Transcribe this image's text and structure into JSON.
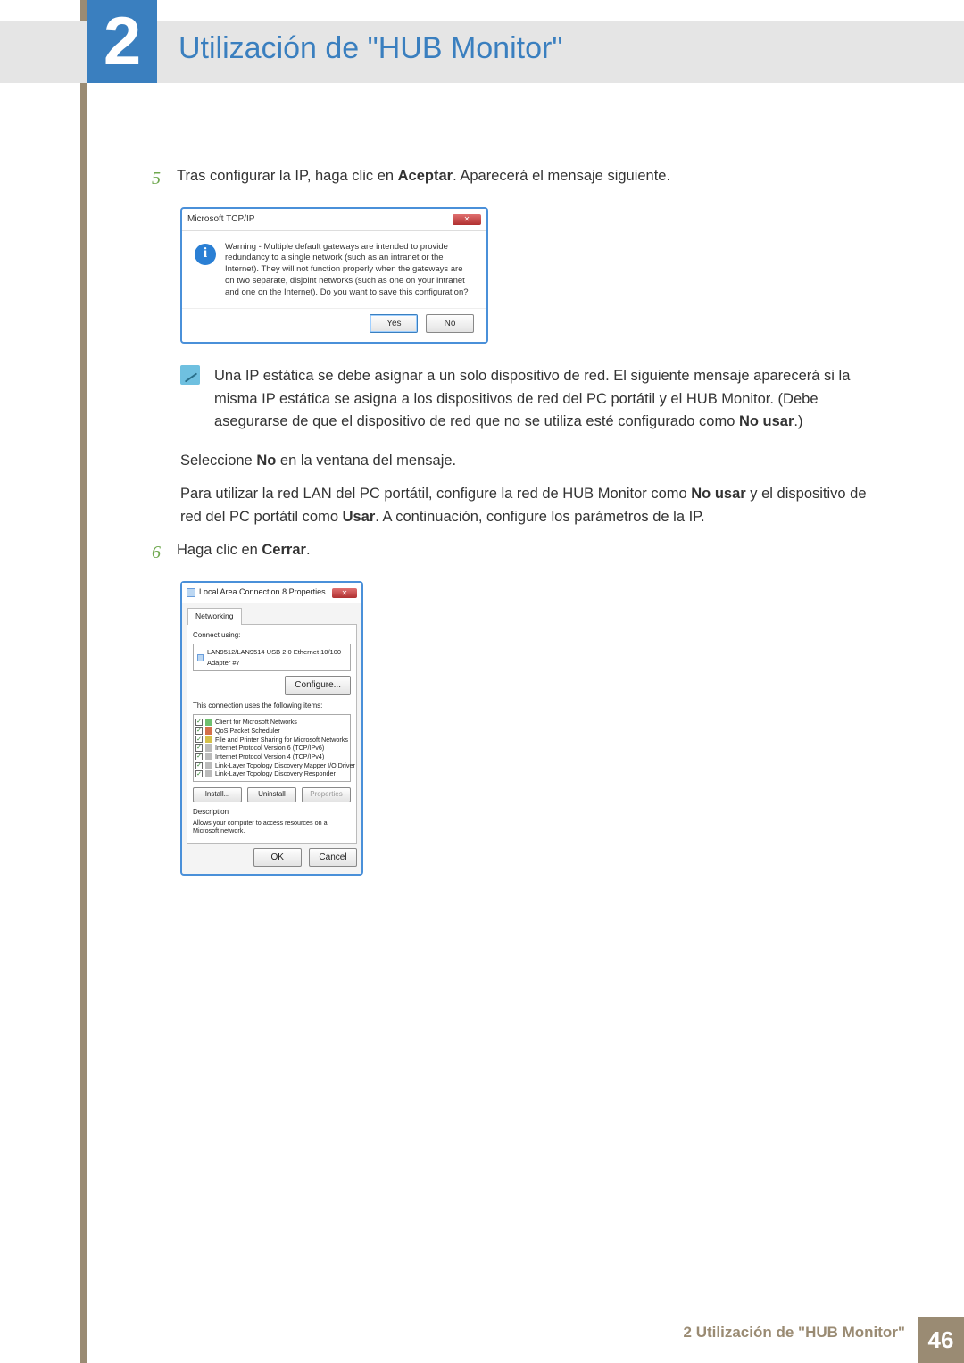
{
  "chapter": {
    "number": "2",
    "title": "Utilización de \"HUB Monitor\""
  },
  "step5": {
    "num": "5",
    "text_pre": "Tras configurar la IP, haga clic en ",
    "text_bold": "Aceptar",
    "text_post": ". Aparecerá el mensaje siguiente."
  },
  "dialog1": {
    "title": "Microsoft TCP/IP",
    "close_glyph": "✕",
    "warning": "Warning - Multiple default gateways are intended to provide redundancy to a single network (such as an intranet or the Internet). They will not function properly when the gateways are on two separate, disjoint networks (such as one on your intranet and one on the Internet). Do you want to save this configuration?",
    "yes": "Yes",
    "no": "No"
  },
  "note": {
    "p1_a": "Una IP estática se debe asignar a un solo dispositivo de red. El siguiente mensaje aparecerá si la misma IP estática se asigna a los dispositivos de red del PC portátil y el HUB Monitor. (Debe asegurarse de que el dispositivo de red que no se utiliza esté configurado como ",
    "p1_bold": "No usar",
    "p1_b": ".)"
  },
  "para_select": {
    "a": "Seleccione ",
    "bold": "No",
    "b": " en la ventana del mensaje."
  },
  "para_lan": {
    "a": "Para utilizar la red LAN del PC portátil, configure la red de HUB Monitor como ",
    "b1": "No usar",
    "c": " y el dispositivo de red del PC portátil como ",
    "b2": "Usar",
    "d": ". A continuación, configure los parámetros de la IP."
  },
  "step6": {
    "num": "6",
    "text_pre": "Haga clic en ",
    "text_bold": "Cerrar",
    "text_post": "."
  },
  "dialog2": {
    "title": "Local Area Connection 8 Properties",
    "close_glyph": "✕",
    "tab": "Networking",
    "connect_using": "Connect using:",
    "adapter": "LAN9512/LAN9514 USB 2.0 Ethernet 10/100 Adapter #7",
    "configure": "Configure...",
    "items_label": "This connection uses the following items:",
    "items": [
      "Client for Microsoft Networks",
      "QoS Packet Scheduler",
      "File and Printer Sharing for Microsoft Networks",
      "Internet Protocol Version 6 (TCP/IPv6)",
      "Internet Protocol Version 4 (TCP/IPv4)",
      "Link-Layer Topology Discovery Mapper I/O Driver",
      "Link-Layer Topology Discovery Responder"
    ],
    "install": "Install...",
    "uninstall": "Uninstall",
    "properties": "Properties",
    "desc_label": "Description",
    "desc_text": "Allows your computer to access resources on a Microsoft network.",
    "ok": "OK",
    "cancel": "Cancel"
  },
  "footer": {
    "label": "2 Utilización de \"HUB Monitor\"",
    "page": "46"
  }
}
